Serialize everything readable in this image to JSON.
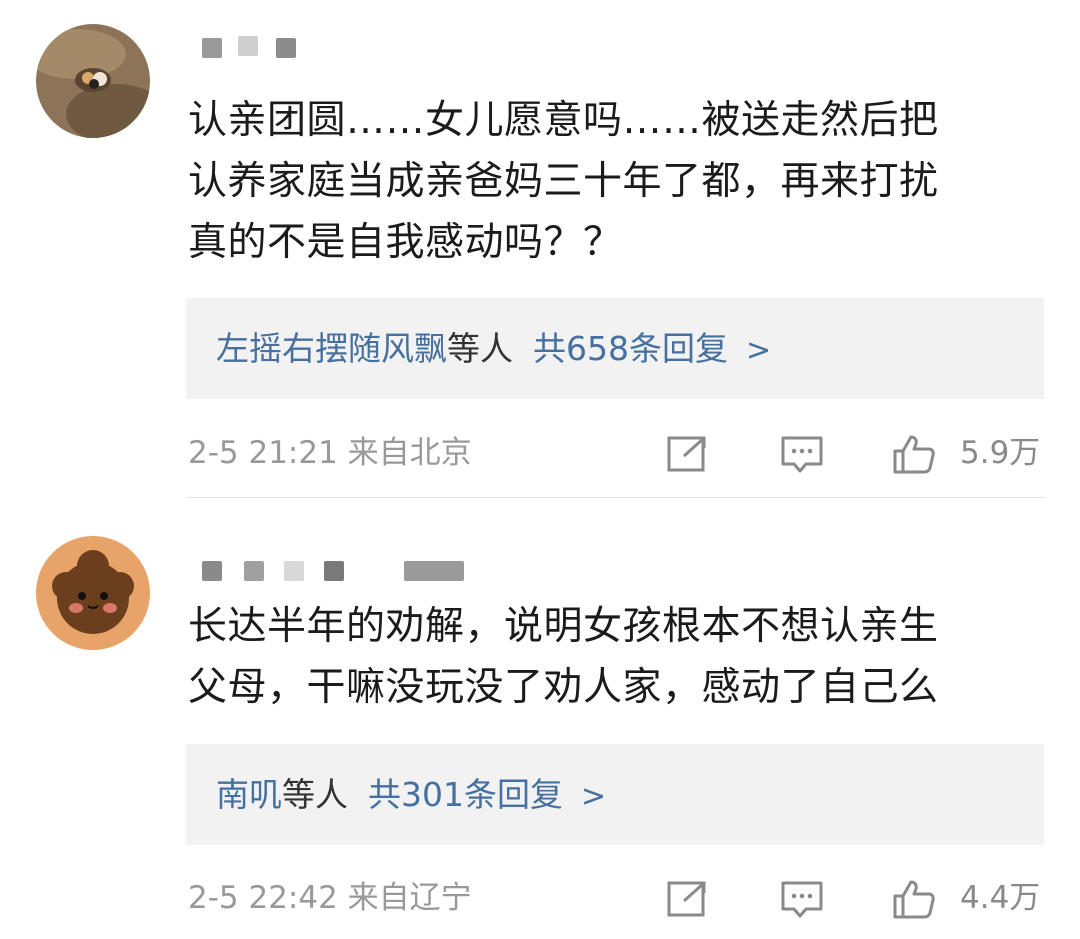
{
  "comments": [
    {
      "text_lines": [
        "认亲团圆……女儿愿意吗……被送走然后把",
        "认养家庭当成亲爸妈三十年了都，再来打扰",
        "真的不是自我感动吗？？"
      ],
      "reply_names": "左摇右摆随风飘",
      "reply_mid": "等人",
      "reply_count": "共658条回复",
      "reply_chevron": ">",
      "time": "2-5 21:21 来自北京",
      "likes": "5.9万"
    },
    {
      "text_lines": [
        "长达半年的劝解，说明女孩根本不想认亲生",
        "父母，干嘛没玩没了劝人家，感动了自己么"
      ],
      "reply_names": "南叽",
      "reply_mid": "等人",
      "reply_count": "共301条回复",
      "reply_chevron": ">",
      "time": "2-5 22:42 来自辽宁",
      "likes": "4.4万"
    }
  ],
  "icons": {
    "share": "share-icon",
    "comment": "comment-icon",
    "like": "thumbs-up-icon"
  },
  "colors": {
    "link": "#45709f",
    "meta": "#999999",
    "reply_bg": "#f2f2f2"
  }
}
